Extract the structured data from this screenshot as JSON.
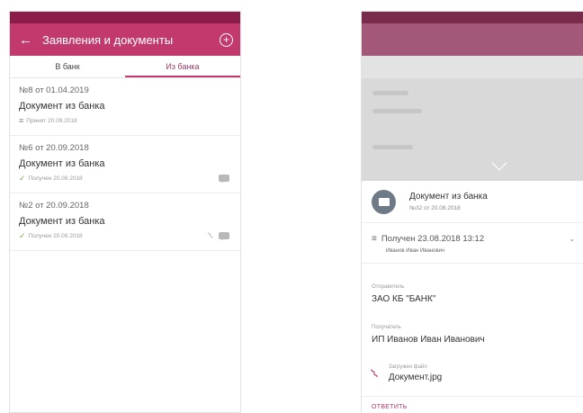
{
  "left": {
    "appbar": {
      "title": "Заявления и документы",
      "back_icon": "←",
      "add_icon": "+"
    },
    "tabs": [
      {
        "label": "В банк"
      },
      {
        "label": "Из банка"
      }
    ],
    "docs": [
      {
        "number": "№8 от 01.04.2019",
        "title": "Документ из банка",
        "status_icon": "≡",
        "status": "Принят 20.09.2018"
      },
      {
        "number": "№6 от 20.09.2018",
        "title": "Документ из банка",
        "status_icon": "✓",
        "status": "Получен 20.09.2018"
      },
      {
        "number": "№2 от 20.09.2018",
        "title": "Документ из банка",
        "status_icon": "✓",
        "status": "Получен 20.09.2018"
      }
    ]
  },
  "right": {
    "sheet": {
      "title": "Документ из банка",
      "subtitle": "№32 от 20.08.2018",
      "received_icon": "≡",
      "received": "Получен 23.08.2018 13:12",
      "received_by": "Иванов Иван Иванович",
      "chevron": "⌄",
      "sender_label": "Отправитель",
      "sender": "ЗАО КБ \"БАНК\"",
      "recipient_label": "Получатель",
      "recipient": "ИП Иванов Иван Иванович",
      "file_label": "Загружен файл",
      "file_name": "Документ.jpg",
      "reply": "ОТВЕТИТЬ"
    }
  },
  "colors": {
    "accent": "#c2396e",
    "status_bar": "#8c1d4b",
    "ok": "#7cab4c"
  }
}
